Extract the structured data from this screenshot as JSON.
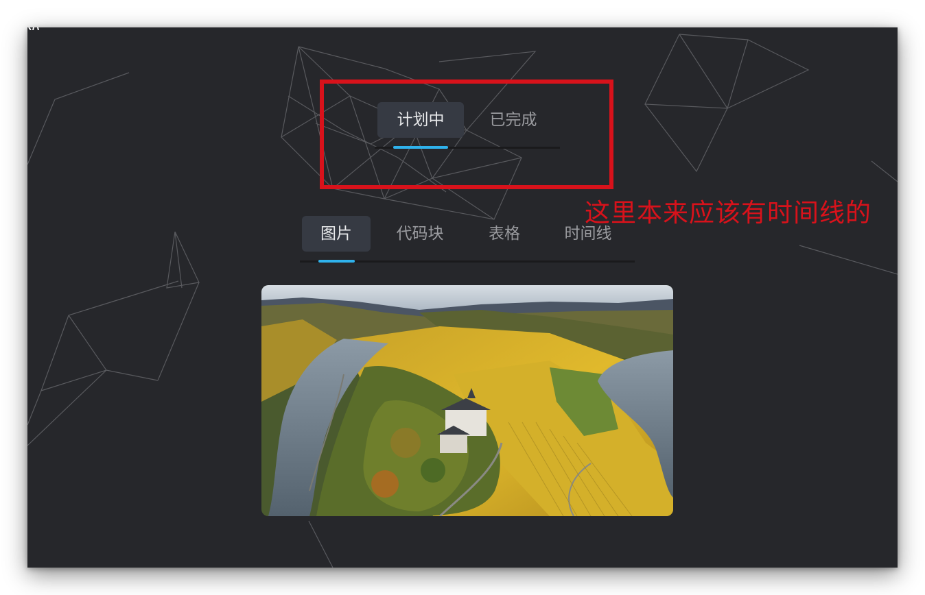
{
  "status_tabs": {
    "items": [
      {
        "label": "计划中",
        "active": true
      },
      {
        "label": "已完成",
        "active": false
      }
    ]
  },
  "content_tabs": {
    "items": [
      {
        "label": "图片",
        "active": true
      },
      {
        "label": "代码块",
        "active": false
      },
      {
        "label": "表格",
        "active": false
      },
      {
        "label": "时间线",
        "active": false
      }
    ]
  },
  "annotation": {
    "text": "这里本来应该有时间线的",
    "color": "#d8121b"
  },
  "image_panel": {
    "subject": "aerial landscape: river bend with vineyards and a hilltop building"
  },
  "colors": {
    "background": "#26272b",
    "active_tab_bg": "#363a43",
    "tab_indicator": "#2fb2ec",
    "annotation_red": "#d8121b"
  }
}
